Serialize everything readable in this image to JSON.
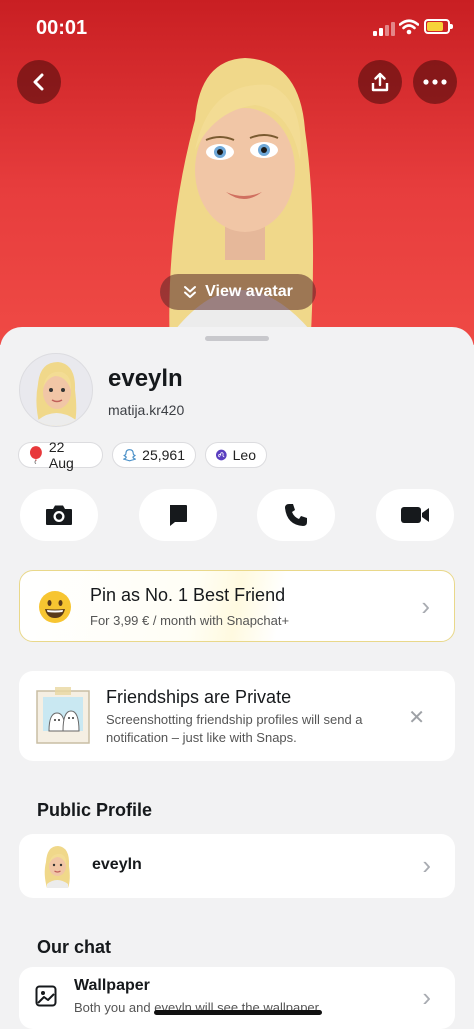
{
  "status_bar": {
    "time": "00:01"
  },
  "hero": {
    "view_avatar_label": "View avatar",
    "colors": {
      "background_top": "#c91f23",
      "background_bottom": "#ef4a45"
    }
  },
  "profile": {
    "display_name": "eveyln",
    "username": "matija.kr420",
    "chips": [
      {
        "icon": "balloon-icon",
        "label": "22 Aug"
      },
      {
        "icon": "snap-score-icon",
        "label": "25,961"
      },
      {
        "icon": "leo-zodiac-icon",
        "label": "Leo"
      }
    ]
  },
  "actions": [
    {
      "name": "camera",
      "icon": "camera-icon"
    },
    {
      "name": "chat",
      "icon": "chat-bubble-icon"
    },
    {
      "name": "call",
      "icon": "phone-icon"
    },
    {
      "name": "video",
      "icon": "video-camera-icon"
    }
  ],
  "pin_card": {
    "title": "Pin as No. 1 Best Friend",
    "subtitle": "For 3,99 € / month with Snapchat+",
    "icon": "grinning-face-icon"
  },
  "privacy_card": {
    "title": "Friendships are Private",
    "body": "Screenshotting friendship profiles will send a notification – just like with Snaps."
  },
  "public_profile": {
    "section_title": "Public Profile",
    "name": "eveyln"
  },
  "our_chat": {
    "section_title": "Our chat",
    "wallpaper_title": "Wallpaper",
    "wallpaper_subtitle": "Both you and eveyln will see the wallpaper"
  }
}
